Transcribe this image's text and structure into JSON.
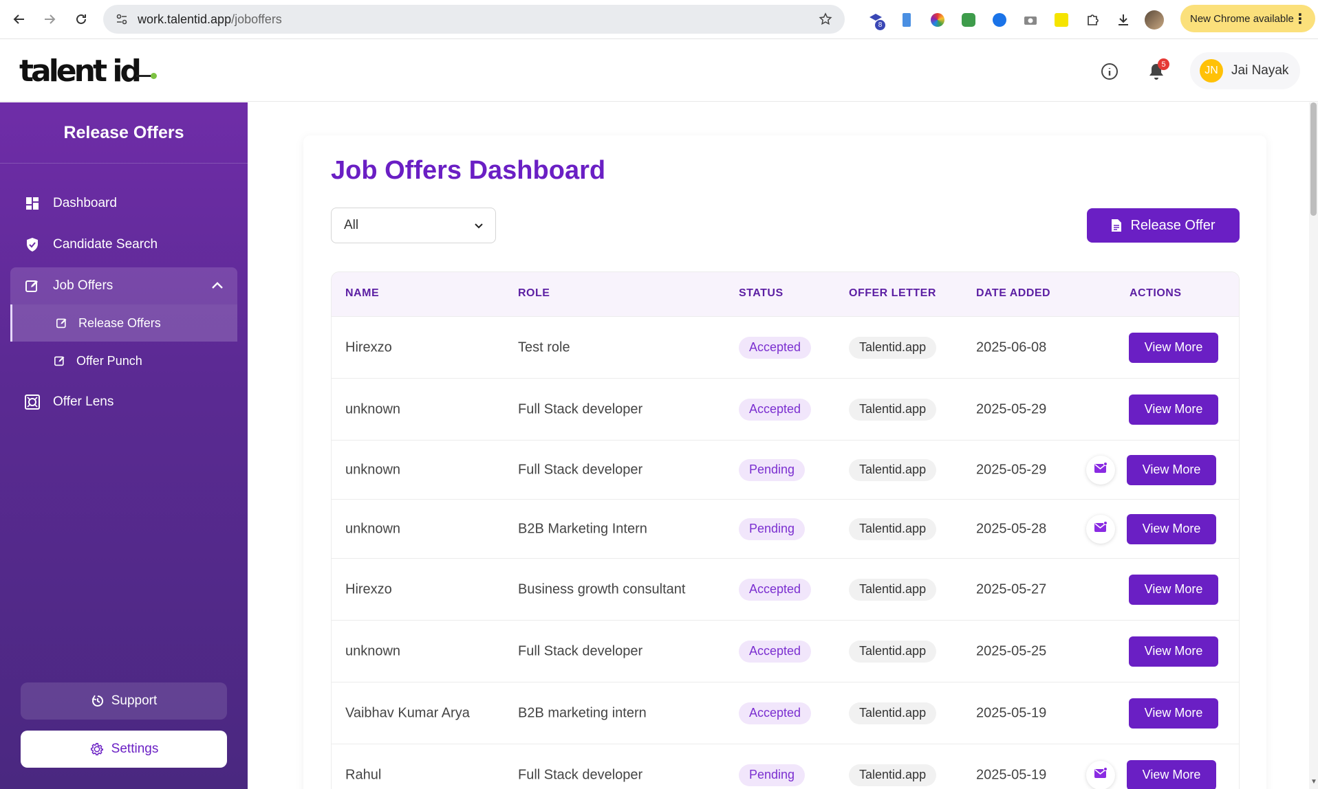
{
  "browser": {
    "url_host": "work.talentid.app",
    "url_path": "/joboffers",
    "update_label": "New Chrome available",
    "ext_badge": "8"
  },
  "header": {
    "logo_text": "talent id",
    "notification_count": "5",
    "user_initials": "JN",
    "user_name": "Jai Nayak"
  },
  "sidebar": {
    "title": "Release Offers",
    "items": [
      {
        "label": "Dashboard",
        "icon": "dashboard-icon"
      },
      {
        "label": "Candidate Search",
        "icon": "shield-icon"
      },
      {
        "label": "Job Offers",
        "icon": "edit-icon"
      },
      {
        "label": "Release Offers",
        "icon": "edit-icon"
      },
      {
        "label": "Offer Punch",
        "icon": "edit-icon"
      },
      {
        "label": "Offer Lens",
        "icon": "lens-icon"
      }
    ],
    "support_label": "Support",
    "settings_label": "Settings"
  },
  "main": {
    "title": "Job Offers Dashboard",
    "filter_value": "All",
    "release_button": "Release Offer",
    "columns": [
      "NAME",
      "ROLE",
      "STATUS",
      "OFFER LETTER",
      "DATE ADDED",
      "ACTIONS"
    ],
    "rows": [
      {
        "name": "Hirexzo",
        "role": "Test role",
        "status": "Accepted",
        "letter": "Talentid.app",
        "date": "2025-06-08",
        "action": "View More",
        "mail": false
      },
      {
        "name": "unknown",
        "role": "Full Stack developer",
        "status": "Accepted",
        "letter": "Talentid.app",
        "date": "2025-05-29",
        "action": "View More",
        "mail": false
      },
      {
        "name": "unknown",
        "role": "Full Stack developer",
        "status": "Pending",
        "letter": "Talentid.app",
        "date": "2025-05-29",
        "action": "View More",
        "mail": true
      },
      {
        "name": "unknown",
        "role": "B2B Marketing Intern",
        "status": "Pending",
        "letter": "Talentid.app",
        "date": "2025-05-28",
        "action": "View More",
        "mail": true
      },
      {
        "name": "Hirexzo",
        "role": "Business growth consultant",
        "status": "Accepted",
        "letter": "Talentid.app",
        "date": "2025-05-27",
        "action": "View More",
        "mail": false
      },
      {
        "name": "unknown",
        "role": "Full Stack developer",
        "status": "Accepted",
        "letter": "Talentid.app",
        "date": "2025-05-25",
        "action": "View More",
        "mail": false
      },
      {
        "name": "Vaibhav Kumar Arya",
        "role": "B2B marketing intern",
        "status": "Accepted",
        "letter": "Talentid.app",
        "date": "2025-05-19",
        "action": "View More",
        "mail": false
      },
      {
        "name": "Rahul",
        "role": "Full Stack developer",
        "status": "Pending",
        "letter": "Talentid.app",
        "date": "2025-05-19",
        "action": "View More",
        "mail": true
      }
    ]
  },
  "colors": {
    "brand": "#6a1fc4",
    "sidebar_top": "#6f2da8",
    "sidebar_bottom": "#4a2880",
    "status_bg": "#f1e6fb",
    "notification": "#e53935",
    "avatar": "#ffc107",
    "update_chip": "#fbe07b"
  }
}
